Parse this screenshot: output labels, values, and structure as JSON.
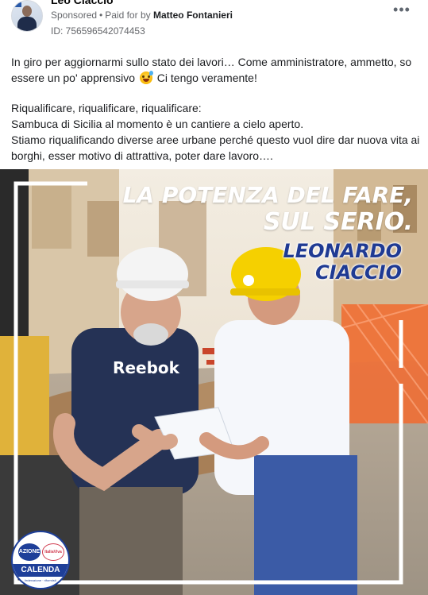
{
  "post": {
    "page_name": "Leo Ciaccio",
    "sponsored_label": "Sponsored",
    "separator": "•",
    "paid_for_label": "Paid for by",
    "payer": "Matteo Fontanieri",
    "ad_id": "ID: 756596542074453",
    "more_icon": "more-horizontal-icon",
    "more_label": "•••"
  },
  "text": {
    "p1_line1": "In giro per aggiornarmi sullo stato dei lavori… Come amministratore, ammetto, so",
    "p1_line2_a": "essere un po' apprensivo",
    "emoji": "grinning-sweat-emoji",
    "p1_line2_b": "Ci tengo veramente!",
    "p2_line1": "Riqualificare, riqualificare, riqualificare:",
    "p2_line2": "Sambuca di Sicilia al momento è un cantiere a cielo aperto.",
    "p2_line3": "Stiamo riqualificando diverse aree urbane perché questo vuol dire dar nuova vita ai",
    "p2_line4": "borghi, esser motivo di attrattiva, poter dare lavoro…."
  },
  "image": {
    "headline_line1": "LA POTENZA DEL FARE,",
    "headline_line2": "SUL SERIO.",
    "candidate_first": "LEONARDO",
    "candidate_last": "CIACCIO",
    "shirt_brand": "Reebok",
    "logo_azione": "AZIONE",
    "logo_italiaviva": "ItaliaViva",
    "logo_calenda": "CALENDA",
    "logo_small": "federazione · riformisti",
    "colors": {
      "headline": "#ffffff",
      "candidate": "#1f3a93",
      "frame": "#ffffff",
      "hardhat_left": "#f4f4f4",
      "hardhat_right": "#f5d000",
      "barrier": "#f26a2e"
    }
  }
}
